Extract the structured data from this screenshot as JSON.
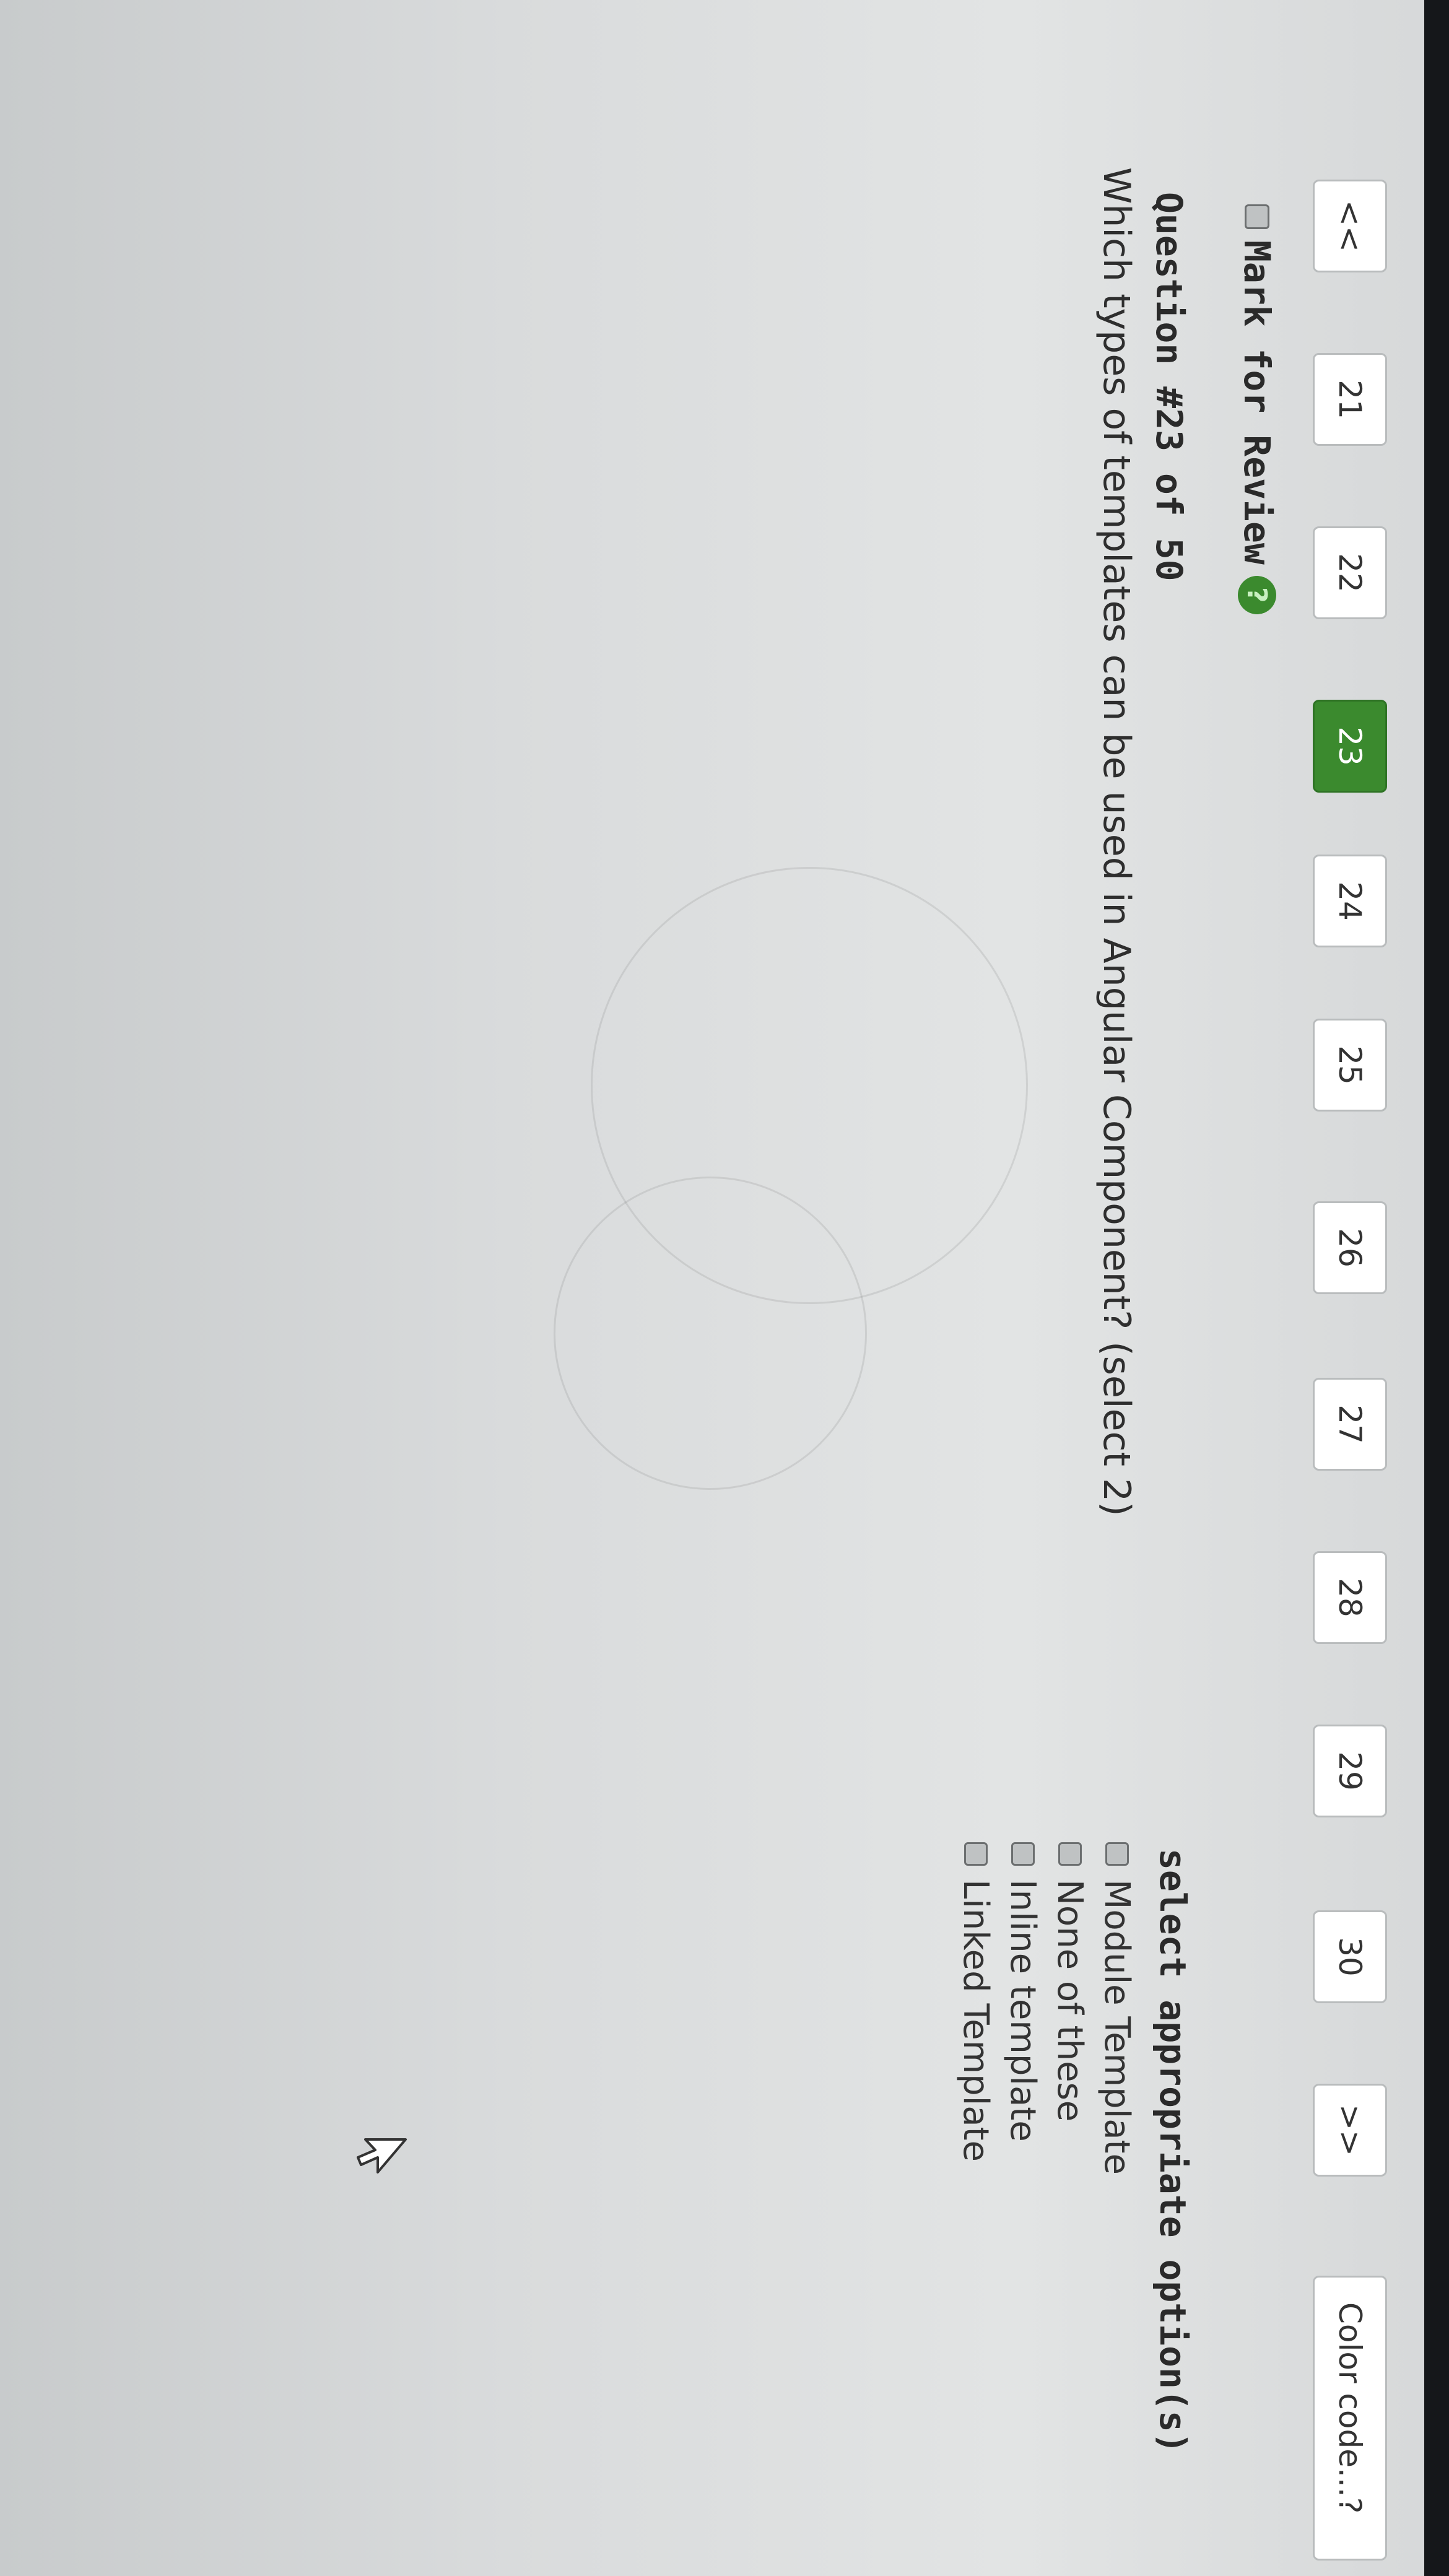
{
  "pager": {
    "prev_label": "<<",
    "pages": [
      "21",
      "22",
      "23",
      "24",
      "25",
      "26",
      "27",
      "28",
      "29",
      "30"
    ],
    "active_page": "23",
    "next_label": ">>",
    "color_code_label": "Color code...?"
  },
  "review": {
    "label": "Mark for Review",
    "help_icon": "?"
  },
  "question": {
    "number_label": "Question #23 of 50",
    "text": "Which types of templates can be used in Angular Component? (select 2)"
  },
  "options": {
    "title": "select appropriate option(s)",
    "items": [
      {
        "label": "Module Template",
        "checked": false
      },
      {
        "label": "None of these",
        "checked": false
      },
      {
        "label": "Inline template",
        "checked": false
      },
      {
        "label": "Linked Template",
        "checked": false
      }
    ]
  },
  "colors": {
    "active_page_bg": "#3b8a2e",
    "button_bg": "#ffffff",
    "button_border": "#b9bcbd",
    "help_icon_bg": "#3b8a2e",
    "text": "#333333"
  }
}
